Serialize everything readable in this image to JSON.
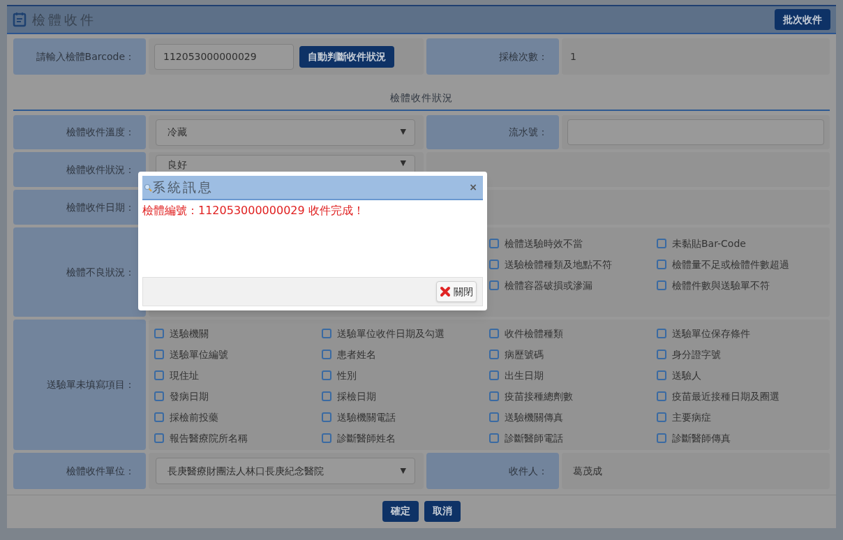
{
  "header": {
    "title": "檢體收件",
    "batch_button": "批次收件"
  },
  "barcode": {
    "label": "請輸入檢體Barcode：",
    "value": "112053000000029",
    "auto_button": "自動判斷收件狀況"
  },
  "sample_count": {
    "label": "採檢次數：",
    "value": "1"
  },
  "section_title": "檢體收件狀況",
  "temperature": {
    "label": "檢體收件溫度：",
    "value": "冷藏",
    "arrow": "▼"
  },
  "serial": {
    "label": "流水號："
  },
  "status": {
    "label": "檢體收件狀況：",
    "value": "良好",
    "arrow": "▼"
  },
  "date": {
    "label": "檢體收件日期："
  },
  "defects": {
    "label": "檢體不良狀況：",
    "options": [
      {
        "label": "檢體送驗時效不當",
        "checked": false
      },
      {
        "label": "未黏貼Bar-Code",
        "checked": false
      },
      {
        "label": "送驗檢體種類及地點不符",
        "checked": false
      },
      {
        "label": "檢體量不足或檢體件數超過",
        "checked": false
      },
      {
        "label": "檢體容器破損或滲漏",
        "checked": false
      },
      {
        "label": "檢體件數與送驗單不符",
        "checked": false
      }
    ]
  },
  "unfilled": {
    "label": "送驗單未填寫項目：",
    "options": [
      {
        "label": "送驗機關",
        "checked": false
      },
      {
        "label": "送驗單位收件日期及勾選",
        "checked": false
      },
      {
        "label": "收件檢體種類",
        "checked": false
      },
      {
        "label": "送驗單位保存條件",
        "checked": false
      },
      {
        "label": "送驗單位編號",
        "checked": false
      },
      {
        "label": "患者姓名",
        "checked": false
      },
      {
        "label": "病歷號碼",
        "checked": false
      },
      {
        "label": "身分證字號",
        "checked": false
      },
      {
        "label": "現住址",
        "checked": false
      },
      {
        "label": "性別",
        "checked": false
      },
      {
        "label": "出生日期",
        "checked": false
      },
      {
        "label": "送驗人",
        "checked": false
      },
      {
        "label": "發病日期",
        "checked": false
      },
      {
        "label": "採檢日期",
        "checked": false
      },
      {
        "label": "疫苗接種總劑數",
        "checked": false
      },
      {
        "label": "疫苗最近接種日期及圈選",
        "checked": false
      },
      {
        "label": "採檢前投藥",
        "checked": false
      },
      {
        "label": "送驗機關電話",
        "checked": false
      },
      {
        "label": "送驗機關傳真",
        "checked": false
      },
      {
        "label": "主要病症",
        "checked": false
      },
      {
        "label": "報告醫療院所名稱",
        "checked": false
      },
      {
        "label": "診斷醫師姓名",
        "checked": false
      },
      {
        "label": "診斷醫師電話",
        "checked": false
      },
      {
        "label": "診斷醫師傳真",
        "checked": false
      }
    ]
  },
  "unit": {
    "label": "檢體收件單位：",
    "value": "長庚醫療財團法人林口長庚紀念醫院",
    "arrow": "▼"
  },
  "receiver": {
    "label": "收件人：",
    "value": "葛茂成"
  },
  "buttons": {
    "confirm": "確定",
    "cancel": "取消"
  },
  "dialog": {
    "title": "系統訊息",
    "close": "×",
    "message": "檢體編號：112053000000029 收件完成！",
    "close_button": "關閉"
  }
}
